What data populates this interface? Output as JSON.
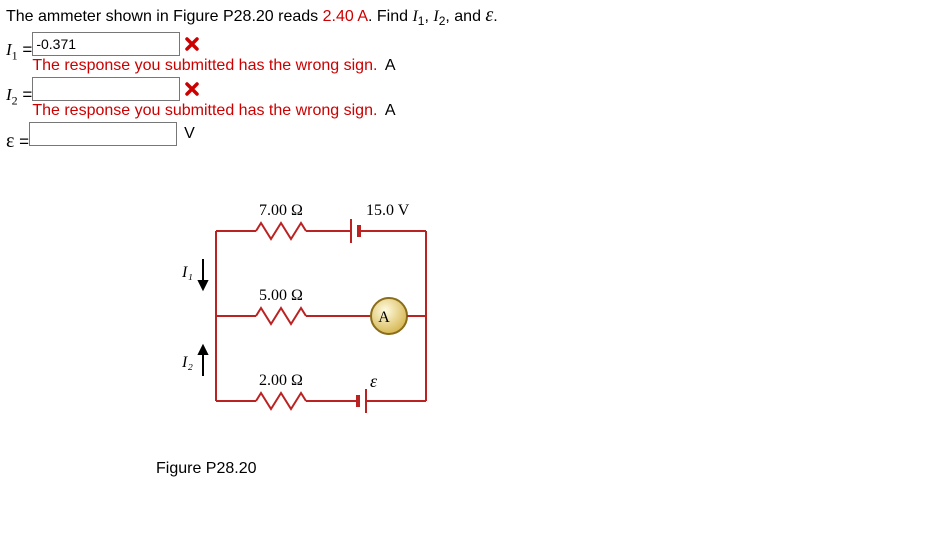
{
  "question": {
    "pre": "The ammeter shown in Figure P28.20 reads ",
    "reading": "2.40 A",
    "post1": ". Find ",
    "i1": "I",
    "i1sub": "1",
    "sep1": ", ",
    "i2": "I",
    "i2sub": "2",
    "sep2": ", and ",
    "emf": "ε",
    "period": "."
  },
  "rows": {
    "i1": {
      "label_sym": "I",
      "label_sub": "1",
      "eq": " = ",
      "value": "-0.371",
      "unit": "A",
      "feedback": "The response you submitted has the wrong sign."
    },
    "i2": {
      "label_sym": "I",
      "label_sub": "2",
      "eq": " = ",
      "value": "",
      "unit": "A",
      "feedback": "The response you submitted has the wrong sign."
    },
    "emf": {
      "label_sym": "ε",
      "eq": " = ",
      "value": "",
      "unit": "V"
    }
  },
  "figure": {
    "r1": "7.00 Ω",
    "v1": "15.0 V",
    "r2": "5.00 Ω",
    "ammeter": "A",
    "r3": "2.00 Ω",
    "emf": "ε",
    "i1": "I₁",
    "i2": "I₂",
    "caption": "Figure P28.20"
  }
}
